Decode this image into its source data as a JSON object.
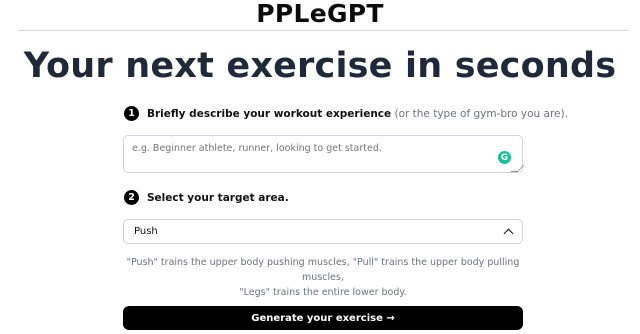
{
  "header": {
    "brand": "PPLeGPT"
  },
  "hero": {
    "title": "Your next exercise in seconds"
  },
  "step1": {
    "number": "1",
    "label": "Briefly describe your workout experience",
    "hint": "(or the type of gym-bro you are)."
  },
  "experience_input": {
    "placeholder": "e.g. Beginner athlete, runner, looking to get started.",
    "value": ""
  },
  "step2": {
    "number": "2",
    "label": "Select your target area."
  },
  "target_select": {
    "value": "Push",
    "icon": "chevron-up-icon"
  },
  "help_text": {
    "line1": "\"Push\" trains the upper body pushing muscles, \"Pull\" trains the upper body pulling muscles,",
    "line2": "\"Legs\" trains the entire lower body."
  },
  "generate_button": {
    "label": "Generate your exercise →"
  },
  "colors": {
    "primary": "#000000",
    "heading": "#1f2937",
    "muted": "#6b7280",
    "grammarly": "#15c39a"
  }
}
